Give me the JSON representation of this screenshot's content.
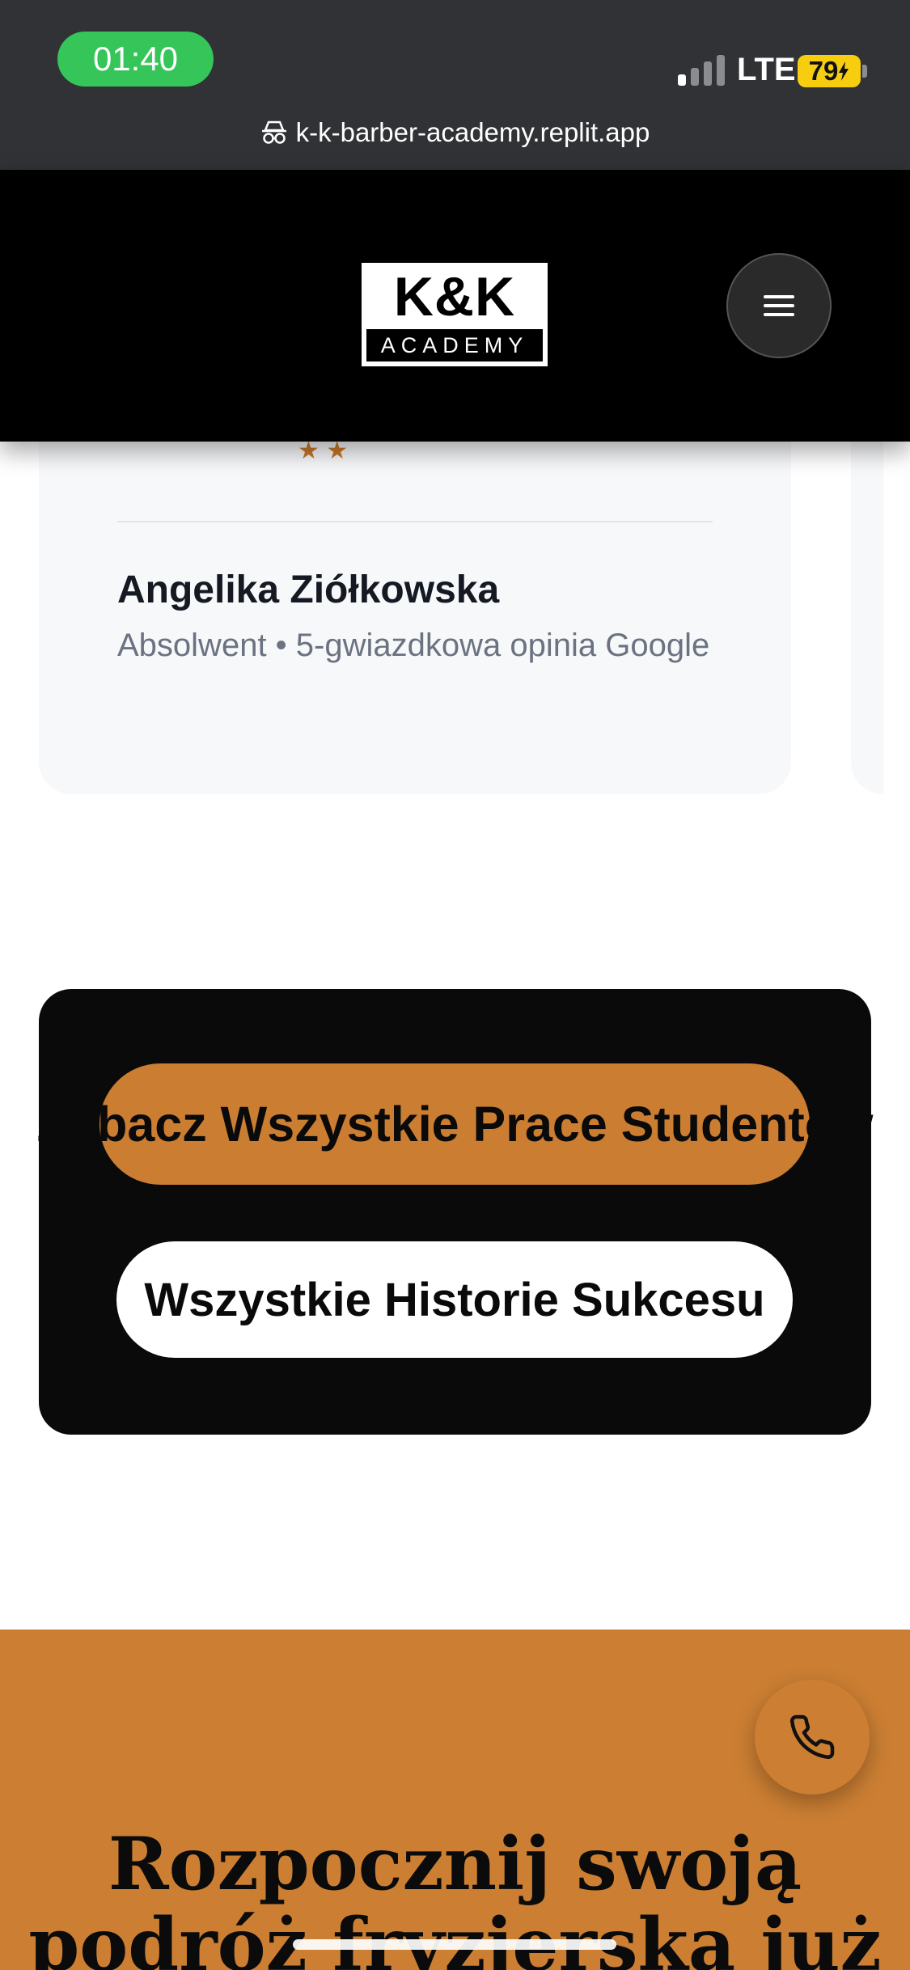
{
  "status_bar": {
    "time": "01:40",
    "network": "LTE",
    "battery": "79",
    "url": "k-k-barber-academy.replit.app"
  },
  "header": {
    "logo_top": "K&K",
    "logo_bottom": "ACADEMY"
  },
  "testimonial": {
    "author": "Angelika Ziółkowska",
    "meta": "Absolwent • 5-gwiazdkowa opinia Google"
  },
  "cta": {
    "primary_label": "Zobacz Wszystkie Prace Studentów",
    "secondary_label": "Wszystkie Historie Sukcesu"
  },
  "bottom": {
    "title": "Rozpocznij swoją podróż fryzjerską już"
  },
  "colors": {
    "accent": "#cb7d31",
    "header_bg": "#000000",
    "status_green": "#35c559"
  }
}
